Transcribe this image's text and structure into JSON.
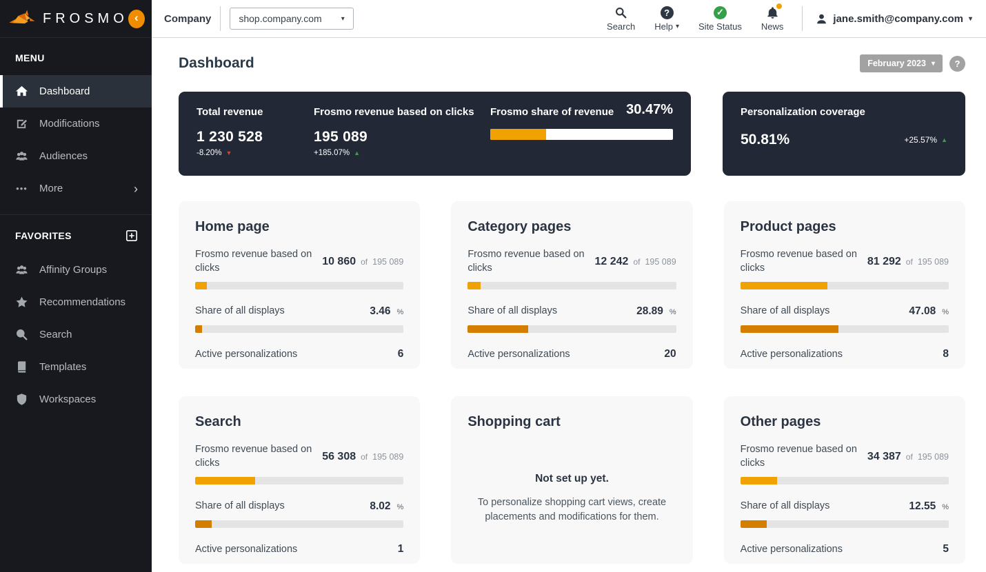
{
  "brand": {
    "name": "FROSMO"
  },
  "icons": {
    "caret_down": "▾",
    "chevron_left": "‹",
    "chevron_right": "›",
    "triangle_up": "▲",
    "triangle_down": "▼",
    "question_mark": "?",
    "check_mark": "✓",
    "ellipsis": "•••"
  },
  "sidebar": {
    "menu_header": "MENU",
    "items": [
      {
        "label": "Dashboard"
      },
      {
        "label": "Modifications"
      },
      {
        "label": "Audiences"
      },
      {
        "label": "More"
      }
    ],
    "favorites_header": "FAVORITES",
    "favorites": [
      {
        "label": "Affinity Groups"
      },
      {
        "label": "Recommendations"
      },
      {
        "label": "Search"
      },
      {
        "label": "Templates"
      },
      {
        "label": "Workspaces"
      }
    ]
  },
  "topbar": {
    "company_label": "Company",
    "site_selector_value": "shop.company.com",
    "actions": {
      "search": "Search",
      "help": "Help",
      "site_status": "Site Status",
      "news": "News"
    },
    "user_email": "jane.smith@company.com"
  },
  "page": {
    "title": "Dashboard",
    "period_selector": "February 2023"
  },
  "overview": {
    "total_revenue": {
      "label": "Total revenue",
      "value": "1 230 528",
      "delta": "-8.20%",
      "direction": "down"
    },
    "frosmo_revenue": {
      "label": "Frosmo revenue based on clicks",
      "value": "195 089",
      "delta": "+185.07%",
      "direction": "up"
    },
    "share_of_revenue": {
      "label": "Frosmo share of revenue",
      "value": "30.47%",
      "bar_pct": 30.47
    },
    "coverage": {
      "label": "Personalization coverage",
      "value": "50.81%",
      "delta": "+25.57%",
      "direction": "up"
    }
  },
  "cards": [
    {
      "title": "Home page",
      "revenue_label": "Frosmo revenue based on clicks",
      "revenue_value": "10 860",
      "revenue_of": "of",
      "revenue_total": "195 089",
      "revenue_pct": 5.6,
      "share_label": "Share of all displays",
      "share_value": "3.46",
      "share_unit": "%",
      "share_pct": 3.46,
      "active_label": "Active personalizations",
      "active_value": "6"
    },
    {
      "title": "Category pages",
      "revenue_label": "Frosmo revenue based on clicks",
      "revenue_value": "12 242",
      "revenue_of": "of",
      "revenue_total": "195 089",
      "revenue_pct": 6.3,
      "share_label": "Share of all displays",
      "share_value": "28.89",
      "share_unit": "%",
      "share_pct": 28.89,
      "active_label": "Active personalizations",
      "active_value": "20"
    },
    {
      "title": "Product pages",
      "revenue_label": "Frosmo revenue based on clicks",
      "revenue_value": "81 292",
      "revenue_of": "of",
      "revenue_total": "195 089",
      "revenue_pct": 41.7,
      "share_label": "Share of all displays",
      "share_value": "47.08",
      "share_unit": "%",
      "share_pct": 47.08,
      "active_label": "Active personalizations",
      "active_value": "8"
    },
    {
      "title": "Search",
      "revenue_label": "Frosmo revenue based on clicks",
      "revenue_value": "56 308",
      "revenue_of": "of",
      "revenue_total": "195 089",
      "revenue_pct": 28.9,
      "share_label": "Share of all displays",
      "share_value": "8.02",
      "share_unit": "%",
      "share_pct": 8.02,
      "active_label": "Active personalizations",
      "active_value": "1"
    },
    {
      "title": "Shopping cart",
      "empty_title": "Not set up yet.",
      "empty_text": "To personalize shopping cart views, create placements and modifications for them."
    },
    {
      "title": "Other pages",
      "revenue_label": "Frosmo revenue based on clicks",
      "revenue_value": "34 387",
      "revenue_of": "of",
      "revenue_total": "195 089",
      "revenue_pct": 17.6,
      "share_label": "Share of all displays",
      "share_value": "12.55",
      "share_unit": "%",
      "share_pct": 12.55,
      "active_label": "Active personalizations",
      "active_value": "5"
    }
  ],
  "colors": {
    "accent_orange": "#f0a202",
    "dark_orange": "#d47e00",
    "brand_orange": "#f08c00",
    "dark_card_bg": "#222836",
    "sidebar_bg": "#17191e",
    "positive_green": "#3f9d49",
    "negative_red": "#cc4733"
  }
}
